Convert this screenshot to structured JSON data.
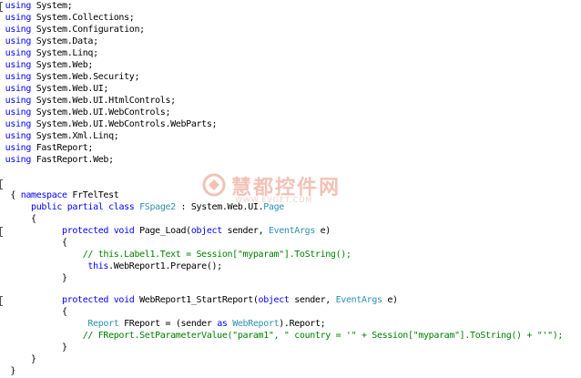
{
  "code": {
    "using_lines": [
      "System;",
      "System.Collections;",
      "System.Configuration;",
      "System.Data;",
      "System.Linq;",
      "System.Web;",
      "System.Web.Security;",
      "System.Web.UI;",
      "System.Web.UI.HtmlControls;",
      "System.Web.UI.WebControls;",
      "System.Web.UI.WebControls.WebParts;",
      "System.Xml.Linq;",
      "FastReport;",
      "FastReport.Web;"
    ],
    "kw_using": "using",
    "kw_namespace": "namespace",
    "namespace_name": " FrTelTest",
    "brace_open": "{",
    "brace_close": "}",
    "class_decl": {
      "public": "public",
      "partial": "partial",
      "class": "class",
      "name": "FSpage2",
      "rest": " : System.Web.UI.",
      "base": "Page"
    },
    "page_load": {
      "protected": "protected",
      "void": "void",
      "sig1": " Page_Load(",
      "object": "object",
      "sig2": " sender, ",
      "argtype": "EventArgs",
      "sig3": " e)",
      "comment": "// this.Label1.Text = Session[\"myparam\"].ToString();",
      "stmt_this": "this",
      "stmt_rest": ".WebReport1.Prepare();"
    },
    "start_report": {
      "protected": "protected",
      "void": "void",
      "sig1": " WebReport1_StartReport(",
      "object": "object",
      "sig2": " sender, ",
      "argtype": "EventArgs",
      "sig3": " e)",
      "stmt_type": "Report",
      "stmt_mid": " FReport = (sender ",
      "stmt_as": "as",
      "stmt_type2": "WebReport",
      "stmt_end": ").Report;",
      "comment": "// FReport.SetParameterValue(\"param1\", \" country = '\" + Session[\"myparam\"].ToString() + \"'\");"
    }
  },
  "watermark": {
    "brand": "慧都控件网",
    "url": "WWW.EVGET.COM"
  },
  "colors": {
    "keyword": "#0000ff",
    "type": "#2b91af",
    "comment": "#008000",
    "text": "#000000"
  }
}
